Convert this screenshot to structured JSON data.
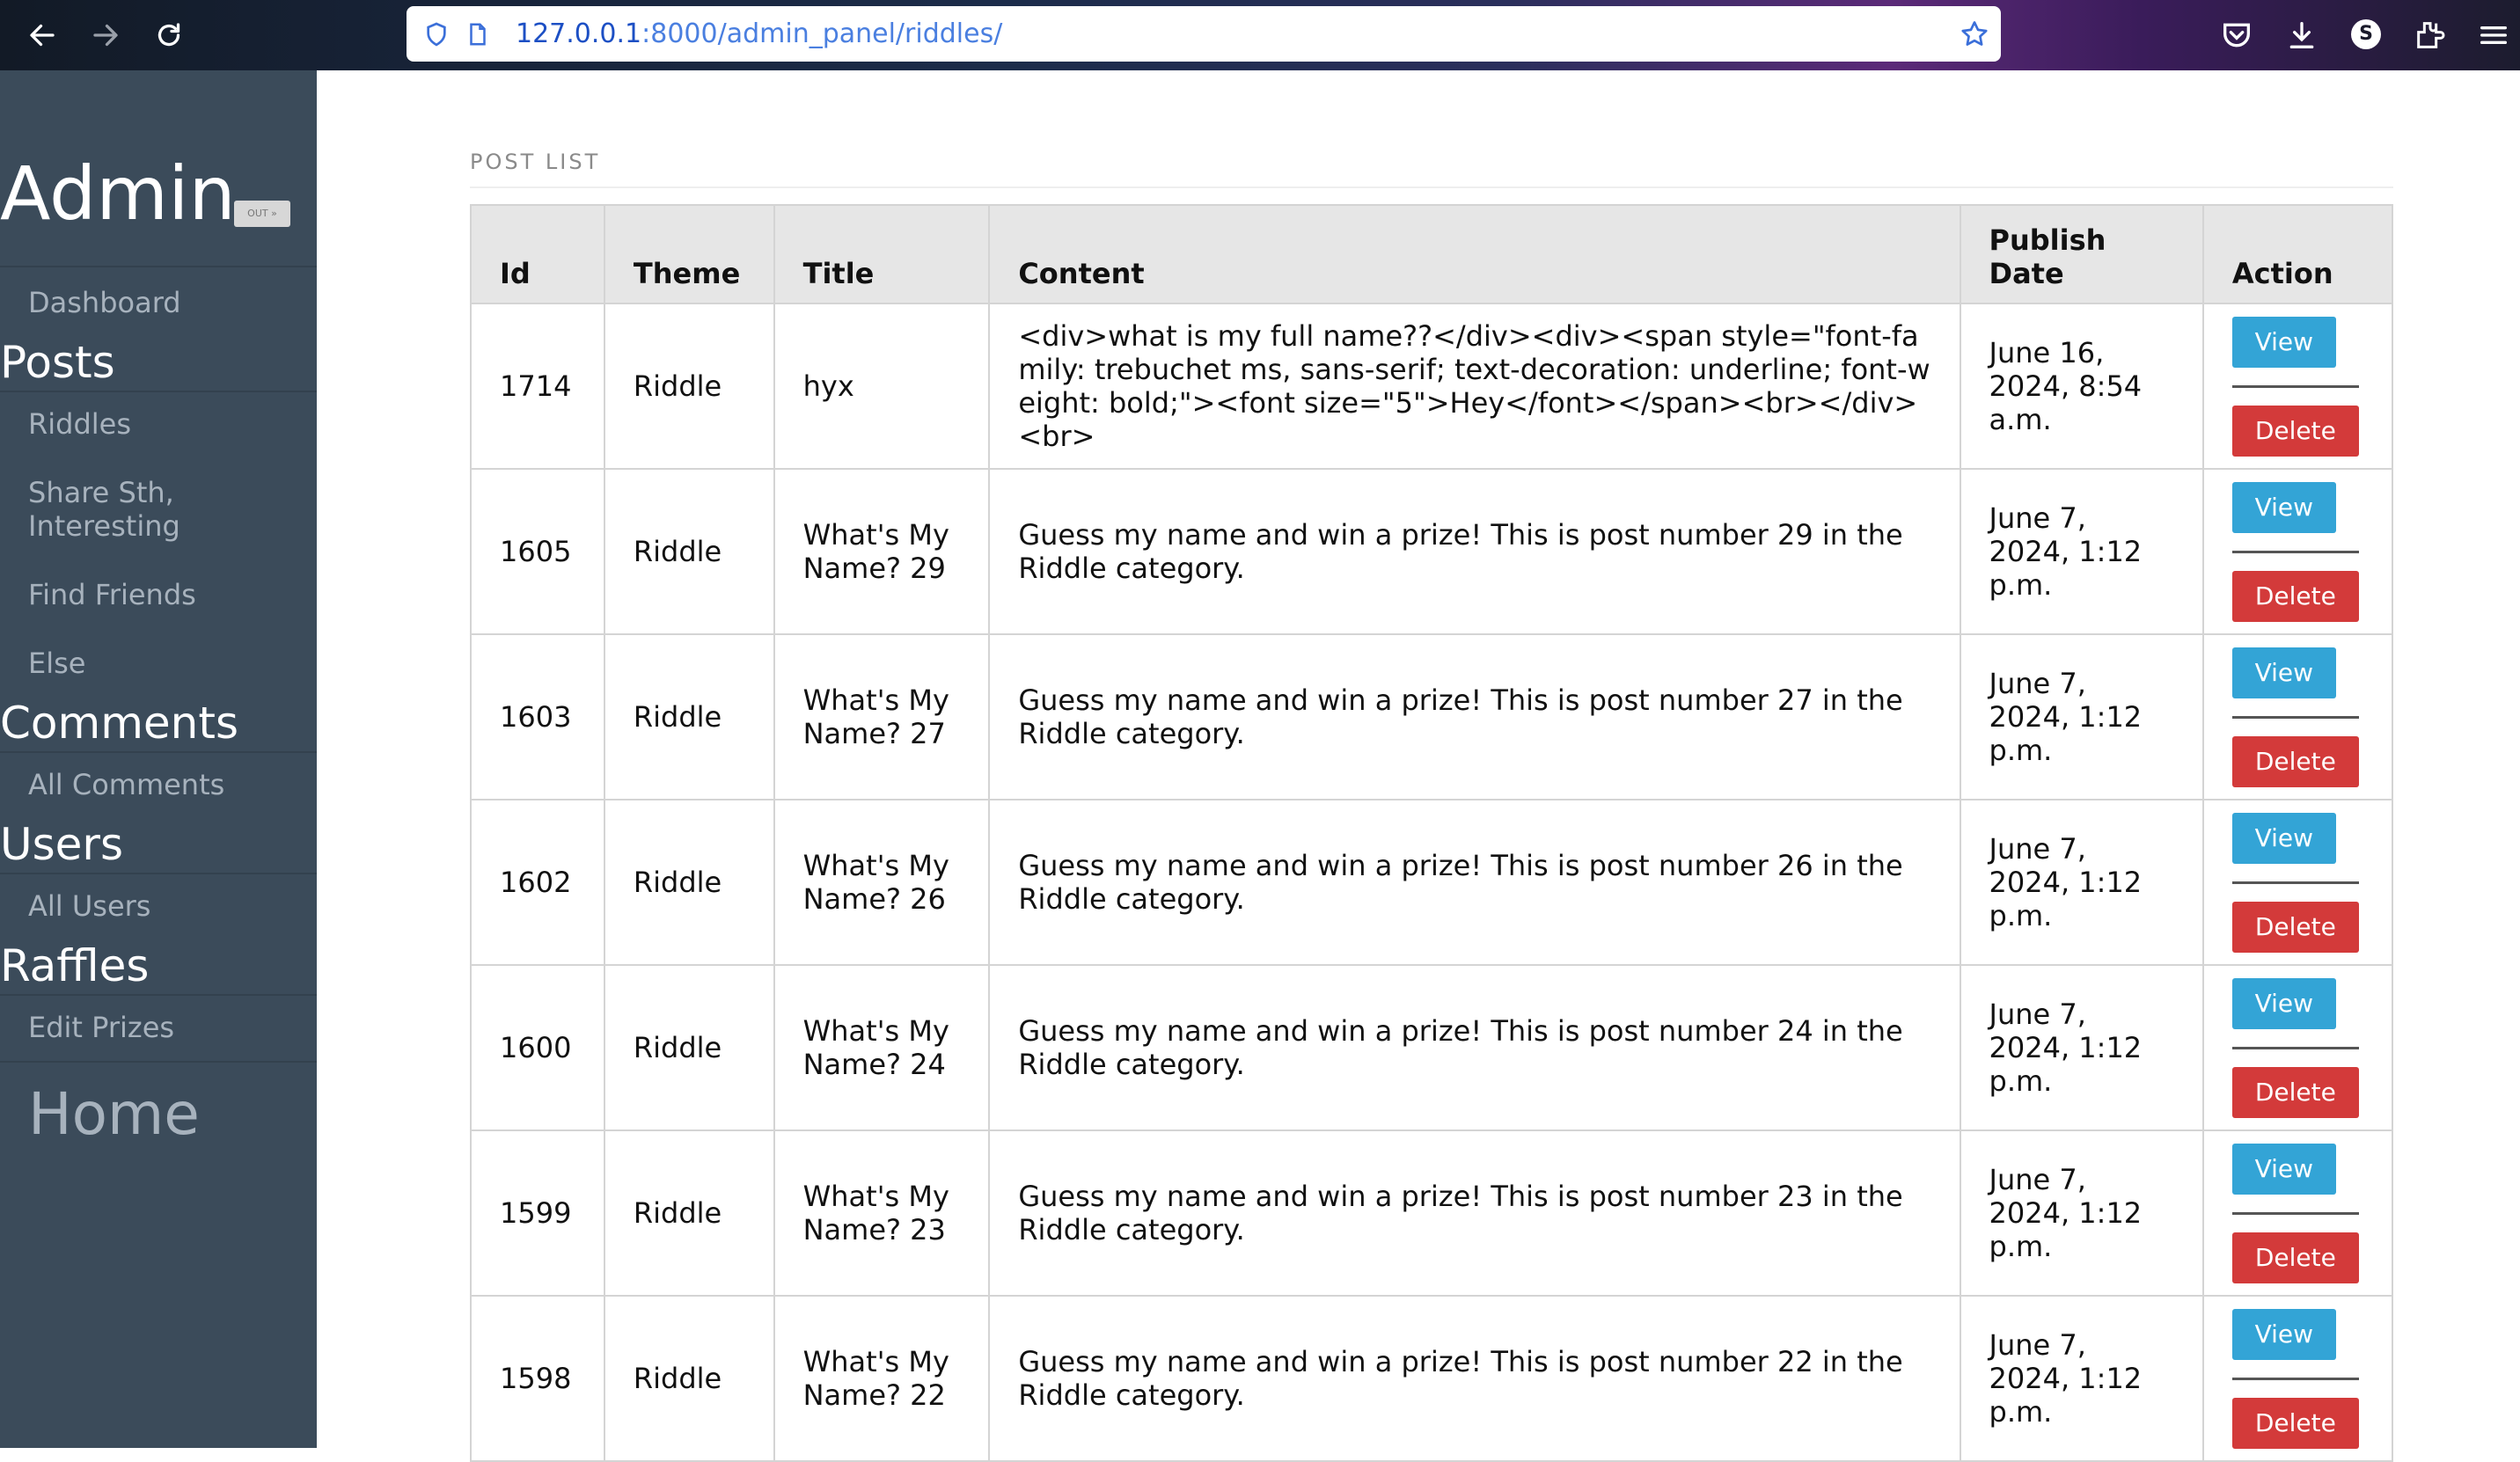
{
  "browser": {
    "url_host": "127.0.0.1",
    "url_rest": ":8000/admin_panel/riddles/",
    "avatar_letter": "S"
  },
  "sidebar": {
    "brand": "Admin",
    "logout_label": "OUT »",
    "dashboard": "Dashboard",
    "sections": [
      {
        "title": "Posts",
        "items": [
          "Riddles",
          "Share Sth, Interesting",
          "Find Friends",
          "Else"
        ]
      },
      {
        "title": "Comments",
        "items": [
          "All Comments"
        ]
      },
      {
        "title": "Users",
        "items": [
          "All Users"
        ]
      },
      {
        "title": "Raffles",
        "items": [
          "Edit Prizes"
        ]
      }
    ],
    "home": "Home"
  },
  "main": {
    "section_title": "POST LIST",
    "columns": [
      "Id",
      "Theme",
      "Title",
      "Content",
      "Publish Date",
      "Action"
    ],
    "view_label": "View",
    "delete_label": "Delete",
    "rows": [
      {
        "id": "1714",
        "theme": "Riddle",
        "title": "hyx",
        "content": "<div>what is my full name??</div><div><span style=\"font-family: trebuchet ms, sans-serif; text-decoration: underline; font-weight: bold;\"><font size=\"5\">Hey</font></span><br></div><br>",
        "date": "June 16, 2024, 8:54 a.m."
      },
      {
        "id": "1605",
        "theme": "Riddle",
        "title": "What's My Name? 29",
        "content": "Guess my name and win a prize! This is post number 29 in the Riddle category.",
        "date": "June 7, 2024, 1:12 p.m."
      },
      {
        "id": "1603",
        "theme": "Riddle",
        "title": "What's My Name? 27",
        "content": "Guess my name and win a prize! This is post number 27 in the Riddle category.",
        "date": "June 7, 2024, 1:12 p.m."
      },
      {
        "id": "1602",
        "theme": "Riddle",
        "title": "What's My Name? 26",
        "content": "Guess my name and win a prize! This is post number 26 in the Riddle category.",
        "date": "June 7, 2024, 1:12 p.m."
      },
      {
        "id": "1600",
        "theme": "Riddle",
        "title": "What's My Name? 24",
        "content": "Guess my name and win a prize! This is post number 24 in the Riddle category.",
        "date": "June 7, 2024, 1:12 p.m."
      },
      {
        "id": "1599",
        "theme": "Riddle",
        "title": "What's My Name? 23",
        "content": "Guess my name and win a prize! This is post number 23 in the Riddle category.",
        "date": "June 7, 2024, 1:12 p.m."
      },
      {
        "id": "1598",
        "theme": "Riddle",
        "title": "What's My Name? 22",
        "content": "Guess my name and win a prize! This is post number 22 in the Riddle category.",
        "date": "June 7, 2024, 1:12 p.m."
      }
    ]
  },
  "colors": {
    "sidebar_bg": "#3b4b5a",
    "view_button": "#33a4d6",
    "delete_button": "#d33a3a",
    "header_bg": "#e6e6e6"
  }
}
